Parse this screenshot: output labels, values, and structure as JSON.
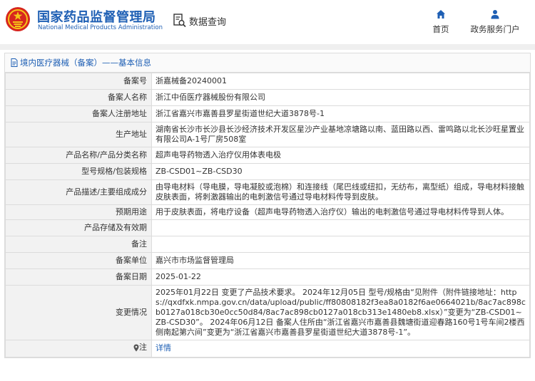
{
  "header": {
    "brand_cn": "国家药品监督管理局",
    "brand_en": "National Medical Products Administration",
    "search_label": "数据查询",
    "nav": [
      {
        "label": "首页",
        "icon": "home-icon"
      },
      {
        "label": "政务服务门户",
        "icon": "user-icon"
      }
    ]
  },
  "breadcrumb": {
    "title": "境内医疗器械（备案）——基本信息",
    "icon": "document-icon"
  },
  "rows": [
    {
      "key": "备案号",
      "value": "浙嘉械备20240001"
    },
    {
      "key": "备案人名称",
      "value": "浙江中佰医疗器械股份有限公司"
    },
    {
      "key": "备案人注册地址",
      "value": "浙江省嘉兴市嘉善县罗星街道世纪大道3878号-1"
    },
    {
      "key": "生产地址",
      "value": "湖南省长沙市长沙县长沙经济技术开发区星沙产业基地凉塘路以南、蓝田路以西、雷鸣路以北长沙旺星置业有限公司A-1号厂房508室"
    },
    {
      "key": "产品名称/产品分类名称",
      "value": "超声电导药物透入治疗仪用体表电极"
    },
    {
      "key": "型号规格/包装规格",
      "value": "ZB-CSD01~ZB-CSD30"
    },
    {
      "key": "产品描述/主要组成成分",
      "value": "由导电材料（导电膜，导电凝胶或泡棉）和连接线（尾巴线或纽扣，无纺布，离型纸）组成，导电材料接触皮肤表面，将刺激器输出的电刺激信号通过导电材料传导到皮肤。"
    },
    {
      "key": "预期用途",
      "value": "用于皮肤表面，将电疗设备（超声电导药物透入治疗仪）输出的电刺激信号通过导电材料传导到人体。"
    },
    {
      "key": "产品存储及有效期",
      "value": ""
    },
    {
      "key": "备注",
      "value": ""
    },
    {
      "key": "备案单位",
      "value": "嘉兴市市场监督管理局"
    },
    {
      "key": "备案日期",
      "value": "2025-01-22"
    },
    {
      "key": "变更情况",
      "value": "2025年01月22日 变更了产品技术要求。 2024年12月05日 型号/规格由“见附件（附件链接地址：https://qxdfxk.nmpa.gov.cn/data/upload/public/ff80808182f3ea8a0182f6ae0664021b/8ac7ac898cb0127a018cb30e0cc50d84/8ac7ac898cb0127a018cb313e1480eb8.xlsx）”变更为“ZB-CSD01~ZB-CSD30”。 2024年06月12日 备案人住所由“浙江省嘉兴市嘉善县魏塘街道迎春路160号1号车间2楼西侧南起第六间”变更为“浙江省嘉兴市嘉善县罗星街道世纪大道3878号-1”。"
    }
  ],
  "note": {
    "key": "注",
    "link_label": "详情"
  },
  "colors": {
    "brand_blue": "#1e5fb4",
    "emblem_red": "#d7261e",
    "emblem_gold": "#f5c518",
    "label_bg": "#f2f2f2",
    "border": "#dcdcdc"
  }
}
